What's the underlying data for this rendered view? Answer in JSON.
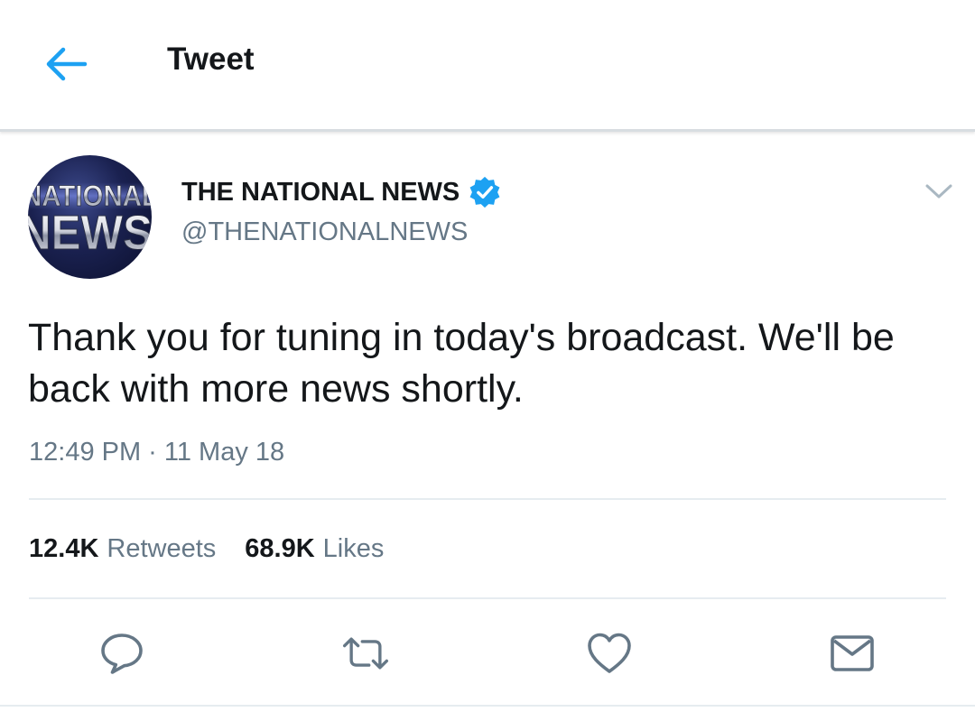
{
  "header": {
    "title": "Tweet",
    "back_icon": "arrow-left-icon"
  },
  "tweet": {
    "author": {
      "name": "THE NATIONAL NEWS",
      "handle": "@THENATIONALNEWS",
      "verified": true,
      "avatar_lines": [
        "NATIONAL",
        "NEWS"
      ]
    },
    "text": "Thank you for tuning in today's broadcast. We'll be back with more news shortly.",
    "timestamp": "12:49 PM · 11 May 18",
    "stats": {
      "retweets_count": "12.4K",
      "retweets_label": "Retweets",
      "likes_count": "68.9K",
      "likes_label": "Likes"
    },
    "actions": [
      "reply-icon",
      "retweet-icon",
      "like-icon",
      "share-mail-icon"
    ]
  },
  "colors": {
    "accent": "#1da1f2",
    "text": "#14171a",
    "secondary": "#657786",
    "divider": "#e6ecf0",
    "action_icon": "#657786"
  }
}
